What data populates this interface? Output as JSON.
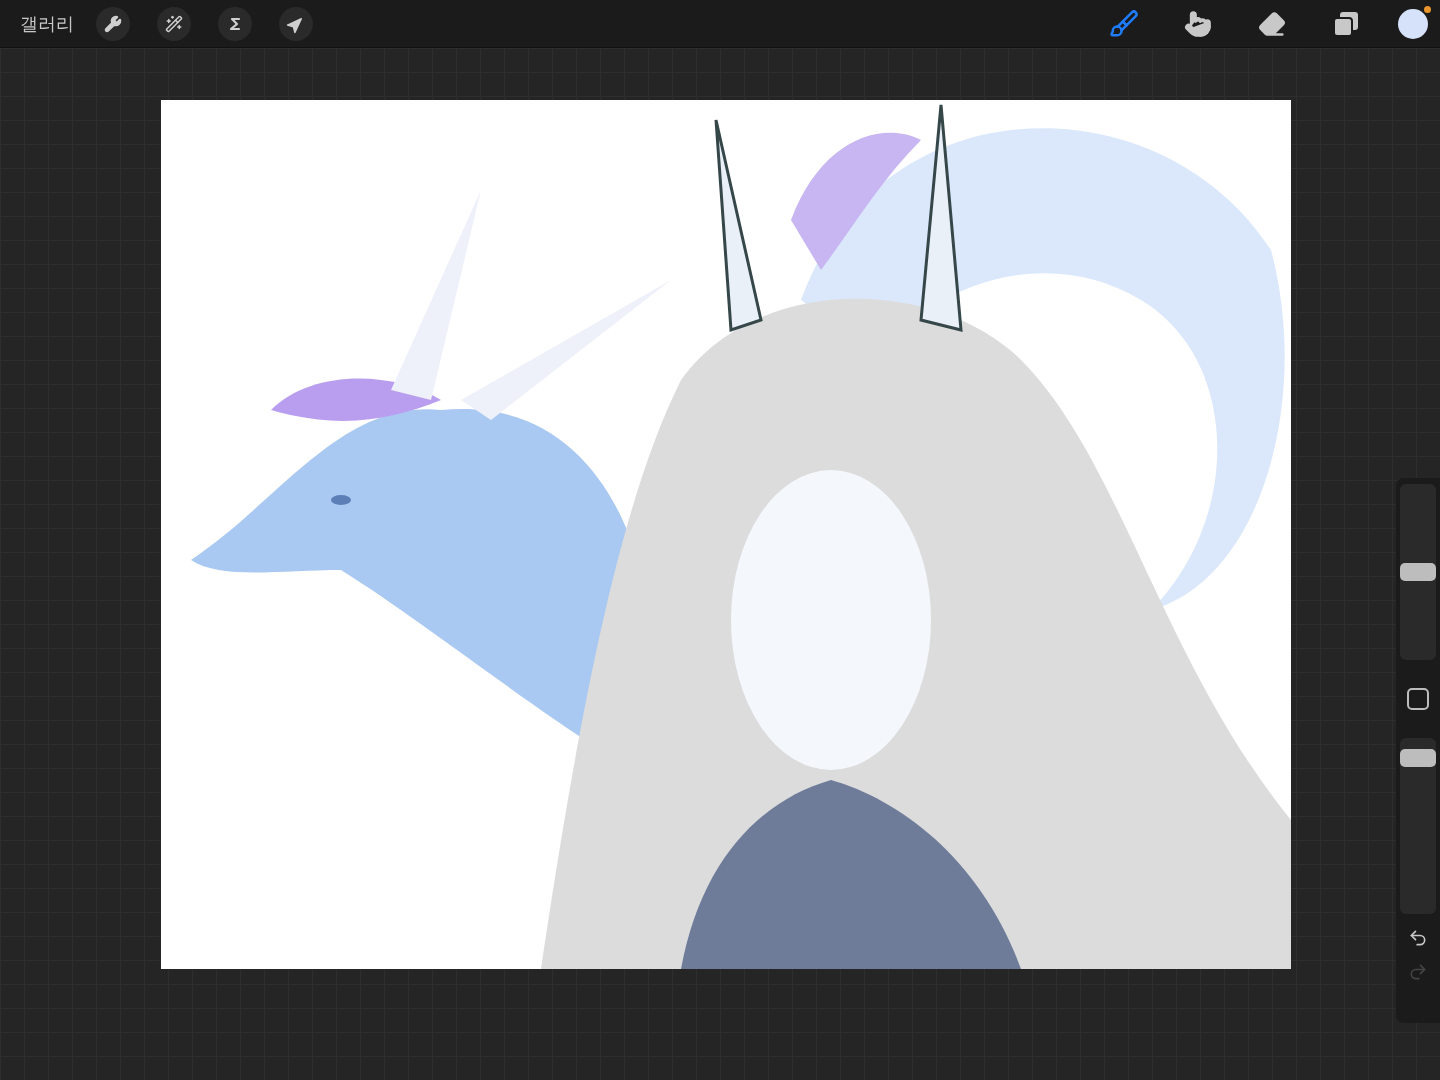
{
  "top_bar": {
    "gallery_label": "갤러리",
    "actions": [
      {
        "kind": "wrench"
      },
      {
        "kind": "wand"
      },
      {
        "kind": "selection"
      },
      {
        "kind": "transform"
      }
    ],
    "tools": [
      {
        "kind": "brush",
        "selected": true
      },
      {
        "kind": "smudge",
        "selected": false
      },
      {
        "kind": "eraser",
        "selected": false
      }
    ]
  },
  "sidebar": {
    "size_slider": {
      "level": 0.5
    },
    "opacity_slider": {
      "level": 0.93
    },
    "undo": {
      "disabled": false
    },
    "redo": {
      "disabled": true
    }
  }
}
